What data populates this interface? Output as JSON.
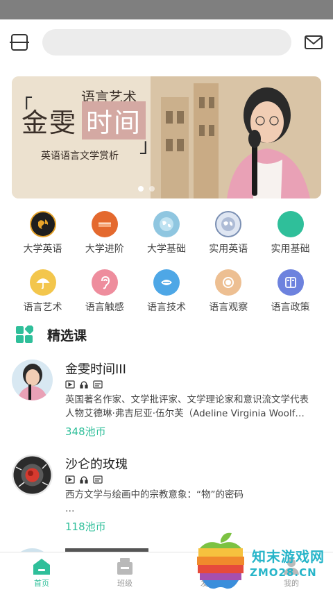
{
  "search": {
    "placeholder": ""
  },
  "banner": {
    "subtitle_top": "语言艺术",
    "title_part1": "金雯",
    "title_part2": "时间",
    "subtitle_bottom": "英语语言文学赏析",
    "bracket_left": "「",
    "bracket_right": "」",
    "slide_count": 2,
    "active_slide": 1
  },
  "categories": {
    "row1": [
      {
        "label": "大学英语",
        "icon": "globe-dark-icon",
        "color": "#1e1e1e"
      },
      {
        "label": "大学进阶",
        "icon": "book-cover-icon",
        "color": "#e4692e"
      },
      {
        "label": "大学基础",
        "icon": "world-map-icon",
        "color": "#8fc6e0"
      },
      {
        "label": "实用英语",
        "icon": "globe-blue-icon",
        "color": "#7a8fb3"
      },
      {
        "label": "实用基础",
        "icon": "circle-icon",
        "color": "#2fbf9a"
      }
    ],
    "row2": [
      {
        "label": "语言艺术",
        "icon": "umbrella-icon",
        "color": "#f3c64c"
      },
      {
        "label": "语言触感",
        "icon": "ear-icon",
        "color": "#ee8d9d"
      },
      {
        "label": "语言技术",
        "icon": "mouth-icon",
        "color": "#4ea7e6"
      },
      {
        "label": "语言观察",
        "icon": "eye-icon",
        "color": "#edbf92"
      },
      {
        "label": "语言政策",
        "icon": "document-icon",
        "color": "#6d82de"
      }
    ]
  },
  "section": {
    "title": "精选课",
    "accent": "#2fbf9a"
  },
  "courses": [
    {
      "title": "金雯时间III",
      "desc": "英国著名作家、文学批评家、文学理论家和意识流文学代表人物艾德琳·弗吉尼亚·伍尔芙（Adeline Virginia Woolf…",
      "price": "348池币"
    },
    {
      "title": "沙仑的玫瑰",
      "desc": "西方文学与绘画中的宗教意象：“物”的密码\n…",
      "price": "118池币"
    }
  ],
  "tabs": [
    {
      "label": "首页",
      "icon": "home-icon",
      "active": true
    },
    {
      "label": "班级",
      "icon": "class-icon",
      "active": false
    },
    {
      "label": "发现",
      "icon": "discover-icon",
      "active": false
    },
    {
      "label": "我的",
      "icon": "profile-icon",
      "active": false
    }
  ],
  "watermark": {
    "line1": "知末游戏网",
    "line2": "ZMO28.CN"
  }
}
